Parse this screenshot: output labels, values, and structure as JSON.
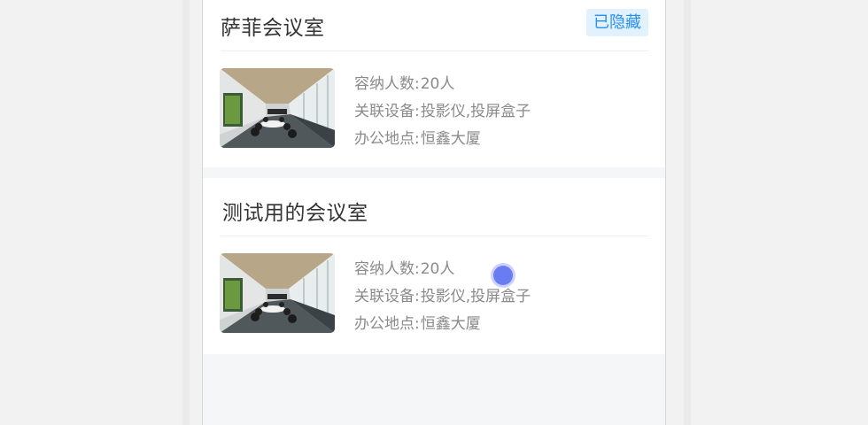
{
  "rooms": [
    {
      "name": "萨菲会议室",
      "badge": "已隐藏",
      "capacity_label": "容纳人数:",
      "capacity_value": "20人",
      "devices_label": "关联设备:",
      "devices_value": "投影仪,投屏盒子",
      "location_label": "办公地点:",
      "location_value": "恒鑫大厦",
      "thumbnail": "conference-room-photo"
    },
    {
      "name": "测试用的会议室",
      "badge": "",
      "capacity_label": "容纳人数:",
      "capacity_value": "20人",
      "devices_label": "关联设备:",
      "devices_value": "投影仪,投屏盒子",
      "location_label": "办公地点:",
      "location_value": "恒鑫大厦",
      "thumbnail": "conference-room-photo"
    }
  ],
  "colors": {
    "badge_bg": "#e1f1fd",
    "badge_text": "#2b8ff0",
    "title_text": "#333333",
    "info_text": "#8a8a8a",
    "cursor": "#6a7cf2"
  }
}
